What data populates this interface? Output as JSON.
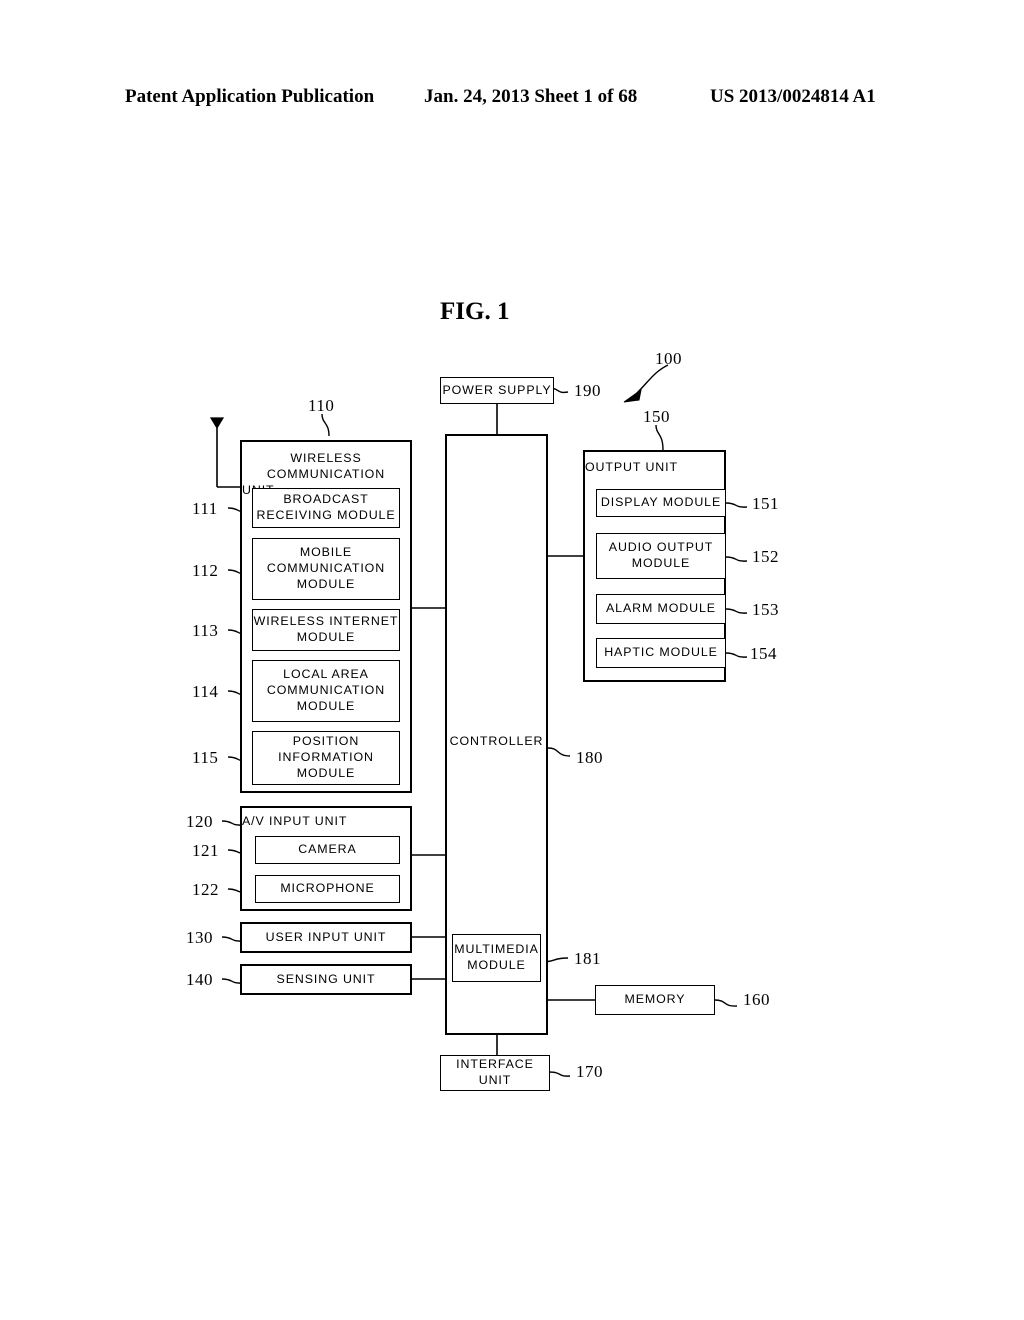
{
  "header": {
    "publication": "Patent Application Publication",
    "date_sheet": "Jan. 24, 2013  Sheet 1 of 68",
    "patent_number": "US 2013/0024814 A1"
  },
  "figure": {
    "title": "FIG. 1",
    "device_ref": "100"
  },
  "blocks": {
    "power_supply": {
      "label": "POWER SUPPLY",
      "ref": "190"
    },
    "controller": {
      "label": "CONTROLLER",
      "ref": "180"
    },
    "multimedia_module": {
      "label": "MULTIMEDIA\nMODULE",
      "line1": "MULTIMEDIA",
      "line2": "MODULE",
      "ref": "181"
    },
    "memory": {
      "label": "MEMORY",
      "ref": "160"
    },
    "interface_unit": {
      "label": "INTERFACE UNIT",
      "ref": "170"
    },
    "wireless_communication_unit": {
      "line1": "WIRELESS COMMUNICATION",
      "line2": "UNIT",
      "ref": "110",
      "children": [
        {
          "line1": "BROADCAST",
          "line2": "RECEIVING MODULE",
          "line3": "",
          "ref": "111"
        },
        {
          "line1": "MOBILE",
          "line2": "COMMUNICATION",
          "line3": "MODULE",
          "ref": "112"
        },
        {
          "line1": "WIRELESS  INTERNET",
          "line2": "MODULE",
          "line3": "",
          "ref": "113"
        },
        {
          "line1": "LOCAL  AREA",
          "line2": "COMMUNICATION",
          "line3": "MODULE",
          "ref": "114"
        },
        {
          "line1": "POSITION",
          "line2": "INFORMATION",
          "line3": "MODULE",
          "ref": "115"
        }
      ]
    },
    "av_input_unit": {
      "label": "A/V  INPUT UNIT",
      "ref": "120",
      "children": [
        {
          "label": "CAMERA",
          "ref": "121"
        },
        {
          "label": "MICROPHONE",
          "ref": "122"
        }
      ]
    },
    "user_input_unit": {
      "label": "USER INPUT UNIT",
      "ref": "130"
    },
    "sensing_unit": {
      "label": "SENSING UNIT",
      "ref": "140"
    },
    "output_unit": {
      "label": "OUTPUT UNIT",
      "ref": "150",
      "children": [
        {
          "line1": "DISPLAY MODULE",
          "line2": "",
          "ref": "151"
        },
        {
          "line1": "AUDIO OUTPUT",
          "line2": "MODULE",
          "ref": "152"
        },
        {
          "line1": "ALARM MODULE",
          "line2": "",
          "ref": "153"
        },
        {
          "line1": "HAPTIC MODULE",
          "line2": "",
          "ref": "154"
        }
      ]
    },
    "antenna": {
      "name": "antenna-symbol"
    }
  }
}
